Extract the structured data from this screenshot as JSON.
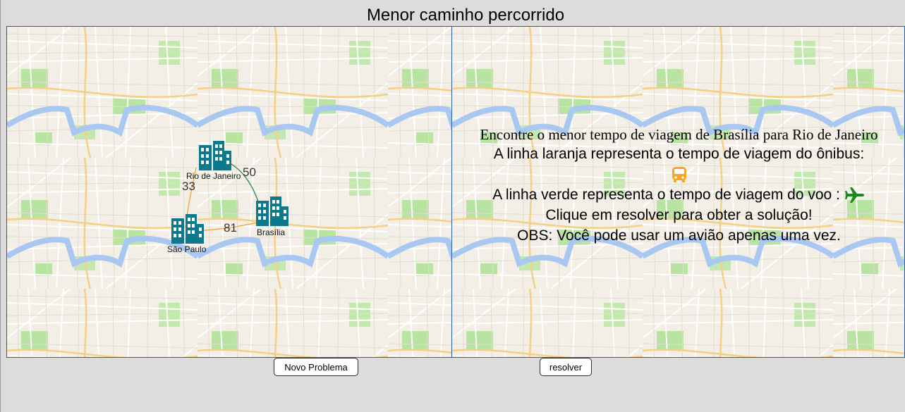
{
  "page": {
    "title": "Menor caminho percorrido"
  },
  "graph": {
    "cities": [
      {
        "name": "Rio de Janeiro"
      },
      {
        "name": "Brasília"
      },
      {
        "name": "São Paulo"
      }
    ],
    "edges": [
      {
        "from": "Rio de Janeiro",
        "to": "Brasília",
        "weight": "50",
        "mode": "plane",
        "color": "#2e8b57"
      },
      {
        "from": "Rio de Janeiro",
        "to": "São Paulo",
        "weight": "33",
        "mode": "bus",
        "color": "#f0a030"
      },
      {
        "from": "São Paulo",
        "to": "Brasília",
        "weight": "81",
        "mode": "bus",
        "color": "#f0a030"
      }
    ],
    "city_color": "#0c7a8c"
  },
  "instructions": {
    "line1": "Encontre o menor tempo de viagem de Brasília para Rio de Janeiro",
    "line2": "A linha laranja representa o tempo de viagem do ônibus:",
    "line3": "A linha verde representa o tempo de viagem do voo :",
    "line4": "Clique em resolver para obter a solução!",
    "line5": "OBS: Você pode usar um avião apenas uma vez.",
    "bus_icon": "bus-icon",
    "plane_icon": "airplane-icon",
    "bus_color": "#f5a623",
    "plane_color": "#1a8a1a"
  },
  "buttons": {
    "new_problem": "Novo Problema",
    "solve": "resolver"
  }
}
